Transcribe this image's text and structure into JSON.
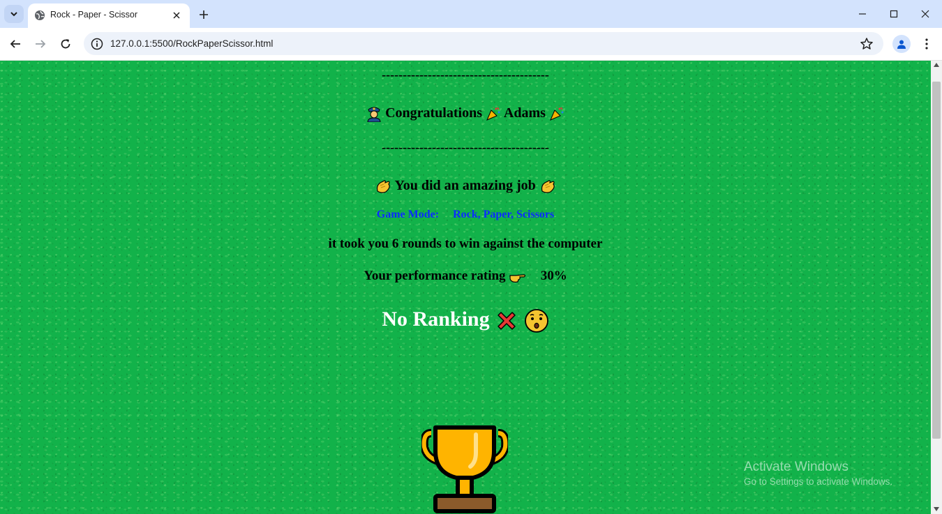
{
  "browser": {
    "tab_title": "Rock - Paper - Scissor",
    "url": "127.0.0.1:5500/RockPaperScissor.html"
  },
  "page": {
    "divider_top": "----------------------------------------",
    "congrats_label": "Congratulations",
    "player_name": "Adams",
    "divider_bottom": "----------------------------------------",
    "amazing_text": "You did an amazing job",
    "game_mode_label": "Game Mode:",
    "game_mode_value": "Rock, Paper, Scissors",
    "rounds_text": "it took you 6 rounds to win against the computer",
    "rating_label": "Your performance rating",
    "rating_value": "30%",
    "ranking_text": "No Ranking"
  },
  "watermark": {
    "title": "Activate Windows",
    "subtitle": "Go to Settings to activate Windows."
  },
  "colors": {
    "background": "#12b24a",
    "game_mode_text": "#0a2bff",
    "ranking_text": "#ffffff"
  },
  "icons": [
    "tab-list-icon",
    "globe-icon",
    "close-icon",
    "plus-icon",
    "minimize-icon",
    "maximize-icon",
    "window-close-icon",
    "back-icon",
    "forward-icon",
    "reload-icon",
    "info-icon",
    "star-icon",
    "profile-icon",
    "kebab-menu-icon",
    "police-officer-icon",
    "party-popper-icon",
    "clapping-hands-icon",
    "pointing-right-icon",
    "cross-mark-icon",
    "hushed-face-icon",
    "trophy-icon"
  ]
}
